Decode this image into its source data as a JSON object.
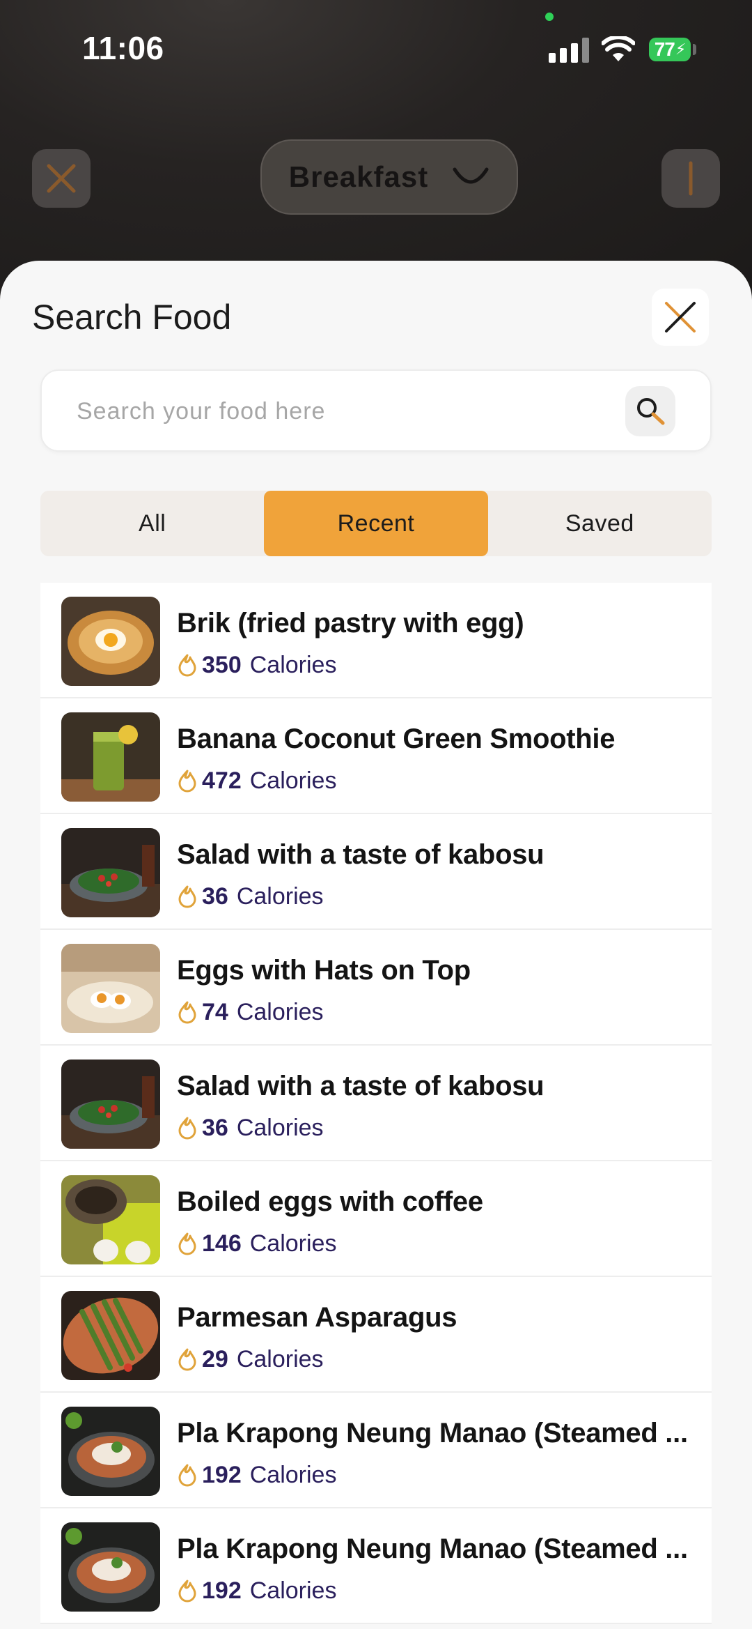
{
  "status_bar": {
    "time": "11:06",
    "battery": "77"
  },
  "background": {
    "meal_label": "Breakfast",
    "close_icon": "close-icon",
    "info_icon": "info-icon"
  },
  "colors": {
    "accent": "#f0a33a",
    "calorie_text": "#2a1f5c",
    "battery_green": "#35c759"
  },
  "sheet": {
    "title": "Search Food",
    "search": {
      "placeholder": "Search your food here",
      "value": ""
    },
    "tabs": [
      {
        "label": "All",
        "active": false
      },
      {
        "label": "Recent",
        "active": true
      },
      {
        "label": "Saved",
        "active": false
      }
    ],
    "calories_unit": "Calories",
    "foods": [
      {
        "name": "Brik (fried pastry with egg)",
        "calories": "350",
        "thumb": "pastry"
      },
      {
        "name": "Banana Coconut Green Smoothie",
        "calories": "472",
        "thumb": "smoothie"
      },
      {
        "name": "Salad with a taste of kabosu",
        "calories": "36",
        "thumb": "salad"
      },
      {
        "name": "Eggs with Hats on Top",
        "calories": "74",
        "thumb": "eggs"
      },
      {
        "name": "Salad with a taste of kabosu",
        "calories": "36",
        "thumb": "salad"
      },
      {
        "name": "Boiled eggs with coffee",
        "calories": "146",
        "thumb": "coffee"
      },
      {
        "name": "Parmesan Asparagus",
        "calories": "29",
        "thumb": "asparagus"
      },
      {
        "name": "Pla Krapong Neung Manao (Steamed ...",
        "calories": "192",
        "thumb": "fish"
      },
      {
        "name": "Pla Krapong Neung Manao (Steamed ...",
        "calories": "192",
        "thumb": "fish"
      }
    ]
  }
}
